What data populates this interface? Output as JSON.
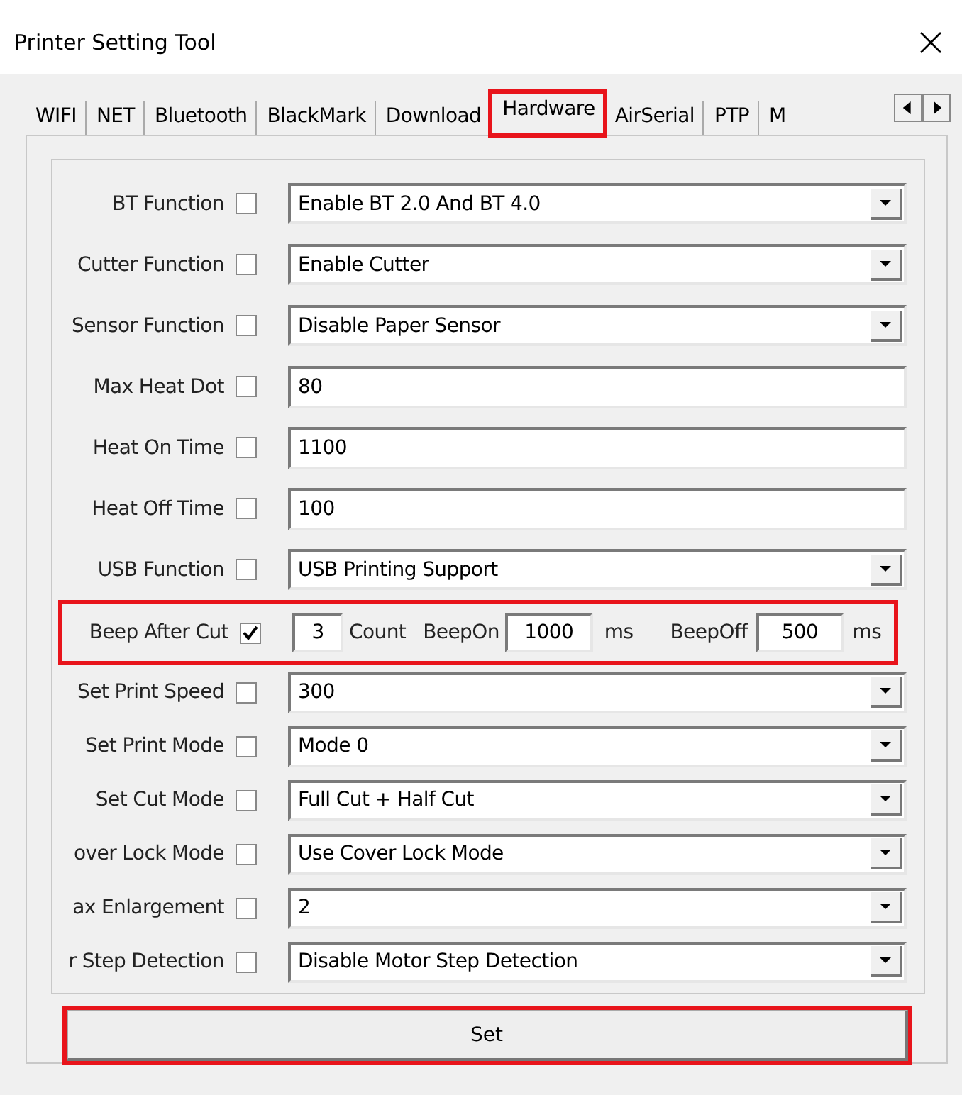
{
  "window": {
    "title": "Printer Setting Tool"
  },
  "tabs": [
    {
      "label": "WIFI",
      "selected": false,
      "highlighted": false
    },
    {
      "label": "NET",
      "selected": false,
      "highlighted": false
    },
    {
      "label": "Bluetooth",
      "selected": false,
      "highlighted": false
    },
    {
      "label": "BlackMark",
      "selected": false,
      "highlighted": false
    },
    {
      "label": "Download",
      "selected": false,
      "highlighted": false
    },
    {
      "label": "Hardware",
      "selected": true,
      "highlighted": true
    },
    {
      "label": "AirSerial",
      "selected": false,
      "highlighted": false
    },
    {
      "label": "PTP",
      "selected": false,
      "highlighted": false
    },
    {
      "label": "M",
      "selected": false,
      "highlighted": false
    }
  ],
  "rows": [
    {
      "kind": "combo",
      "label": "BT Function",
      "checked": false,
      "value": "Enable BT 2.0 And BT 4.0"
    },
    {
      "kind": "combo",
      "label": "Cutter Function",
      "checked": false,
      "value": "Enable Cutter"
    },
    {
      "kind": "combo",
      "label": "Sensor Function",
      "checked": false,
      "value": "Disable Paper Sensor"
    },
    {
      "kind": "text",
      "label": "Max Heat Dot",
      "checked": false,
      "value": "80"
    },
    {
      "kind": "text",
      "label": "Heat On Time",
      "checked": false,
      "value": "1100"
    },
    {
      "kind": "text",
      "label": "Heat Off Time",
      "checked": false,
      "value": "100"
    },
    {
      "kind": "combo",
      "label": "USB Function",
      "checked": false,
      "value": "USB Printing Support"
    },
    {
      "kind": "beep",
      "label": "Beep After Cut",
      "checked": true,
      "highlighted": true,
      "count": "3",
      "count_unit": "Count",
      "beep_on_label": "BeepOn",
      "beep_on": "1000",
      "beep_on_unit": "ms",
      "beep_off_label": "BeepOff",
      "beep_off": "500",
      "beep_off_unit": "ms"
    },
    {
      "kind": "combo",
      "label": "Set Print Speed",
      "checked": false,
      "value": "300"
    },
    {
      "kind": "combo",
      "label": "Set Print Mode",
      "checked": false,
      "value": "Mode 0"
    },
    {
      "kind": "combo",
      "label": "Set Cut Mode",
      "checked": false,
      "value": "Full Cut + Half Cut"
    },
    {
      "kind": "combo",
      "label": "over Lock Mode",
      "checked": false,
      "value": "Use Cover Lock Mode"
    },
    {
      "kind": "combo",
      "label": "ax Enlargement",
      "checked": false,
      "value": "2"
    },
    {
      "kind": "combo",
      "label": "r Step Detection",
      "checked": false,
      "value": "Disable Motor Step Detection"
    }
  ],
  "set_button": {
    "label": "Set",
    "highlighted": true
  }
}
